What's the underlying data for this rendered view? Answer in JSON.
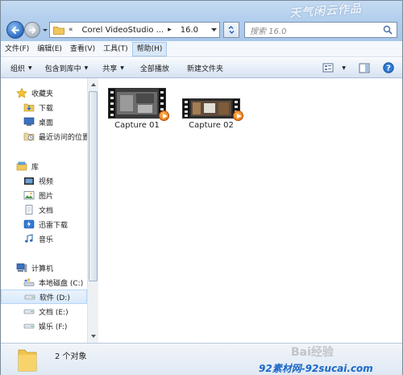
{
  "window": {
    "title_watermark": "天气闲云作品"
  },
  "address_bar": {
    "path_prefix": "«",
    "path_parent": "Corel VideoStudio ...",
    "path_current": "16.0",
    "separator": "▸"
  },
  "search": {
    "placeholder": "搜索 16.0"
  },
  "menubar": {
    "items": [
      {
        "label": "文件(F)"
      },
      {
        "label": "编辑(E)"
      },
      {
        "label": "查看(V)"
      },
      {
        "label": "工具(T)"
      },
      {
        "label": "帮助(H)"
      }
    ]
  },
  "toolbar": {
    "organize": "组织",
    "include_library": "包含到库中",
    "share": "共享",
    "play_all": "全部播放",
    "new_folder": "新建文件夹"
  },
  "sidebar": {
    "favorites": {
      "label": "收藏夹",
      "items": [
        {
          "label": "下载",
          "icon": "download-folder-icon"
        },
        {
          "label": "桌面",
          "icon": "desktop-icon"
        },
        {
          "label": "最近访问的位置",
          "icon": "recent-places-icon"
        }
      ]
    },
    "libraries": {
      "label": "库",
      "items": [
        {
          "label": "视频",
          "icon": "video-library-icon"
        },
        {
          "label": "图片",
          "icon": "pictures-library-icon"
        },
        {
          "label": "文档",
          "icon": "documents-library-icon"
        },
        {
          "label": "迅雷下载",
          "icon": "thunder-download-icon"
        },
        {
          "label": "音乐",
          "icon": "music-library-icon"
        }
      ]
    },
    "computer": {
      "label": "计算机",
      "items": [
        {
          "label": "本地磁盘 (C:)",
          "icon": "local-disk-icon"
        },
        {
          "label": "软件 (D:)",
          "icon": "drive-icon",
          "selected": true
        },
        {
          "label": "文档 (E:)",
          "icon": "drive-icon"
        },
        {
          "label": "娱乐 (F:)",
          "icon": "drive-icon"
        }
      ]
    }
  },
  "files": [
    {
      "name": "Capture 01",
      "icon": "video-file-icon"
    },
    {
      "name": "Capture 02",
      "icon": "video-file-icon"
    }
  ],
  "details": {
    "count": "2 个对象"
  },
  "watermarks": {
    "baidu": "Bai经验",
    "site": "92素材网-92sucai.com"
  }
}
